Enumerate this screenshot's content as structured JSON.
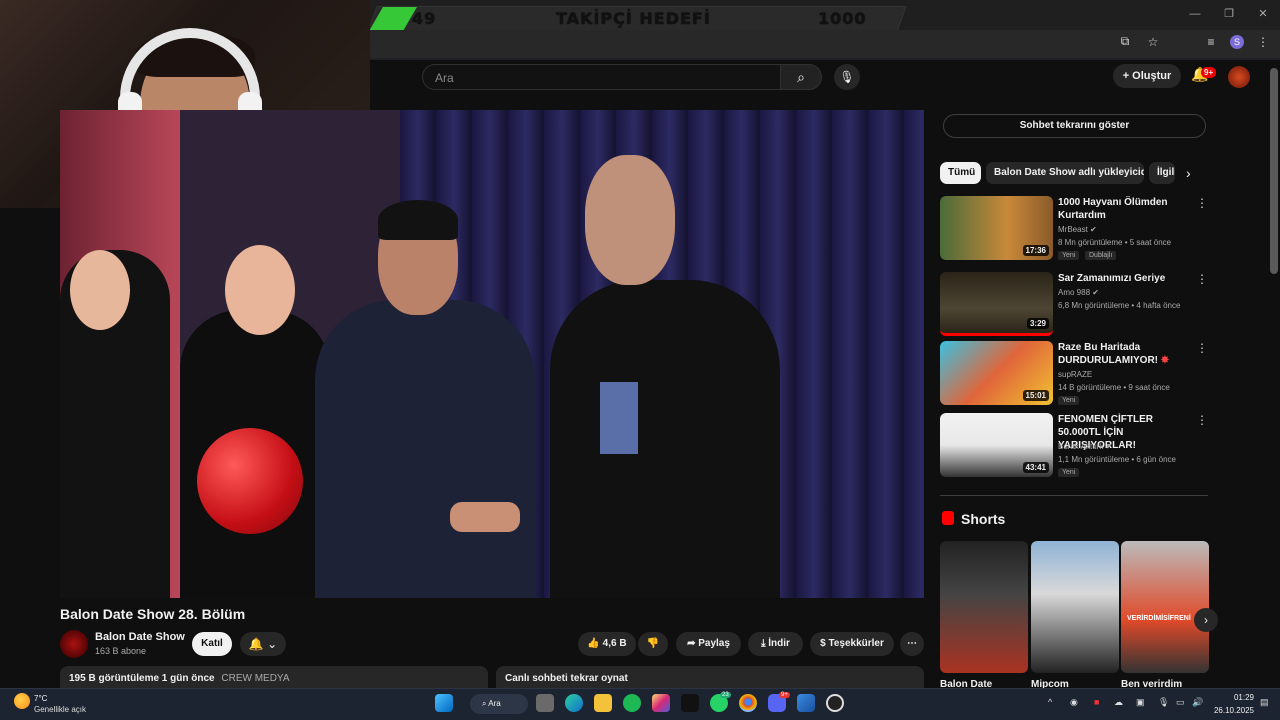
{
  "overlay": {
    "goal_left": "49",
    "goal_label": "TAKİPÇİ HEDEFİ",
    "goal_right": "1000"
  },
  "header": {
    "search_placeholder": "Ara",
    "create_label": "Oluştur",
    "notif_badge": "9+"
  },
  "video": {
    "title": "Balon Date Show 28. Bölüm",
    "channel": "Balon Date Show",
    "subscribers": "163 B abone",
    "join_label": "Katıl",
    "likes": "4,6 B",
    "share_label": "Paylaş",
    "download_label": "İndir",
    "thanks_label": "Teşekkürler",
    "views_line": "195 B görüntüleme  1 gün önce",
    "views_tag": "CREW MEDYA",
    "chat_replay": "Canlı sohbeti tekrar oynat"
  },
  "sidebar": {
    "show_chat": "Sohbet tekrarını göster",
    "chips": [
      "Tümü",
      "Balon Date Show adlı yükleyiciden",
      "İlgili"
    ],
    "recs": [
      {
        "title": "1000 Hayvanı Ölümden Kurtardım",
        "channel": "MrBeast",
        "meta": "8 Mn görüntüleme • 5 saat önce",
        "badge1": "Yeni",
        "badge2": "Dublajlı",
        "duration": "17:36"
      },
      {
        "title": "Sar Zamanımızı Geriye",
        "channel": "Amo 988",
        "meta": "6,8 Mn görüntüleme • 4 hafta önce",
        "duration": "3:29"
      },
      {
        "title": "Raze Bu Haritada DURDURULAMIYOR!",
        "channel": "supRAZE",
        "meta": "14 B görüntüleme • 9 saat önce",
        "badge1": "Yeni",
        "duration": "15:01"
      },
      {
        "title": "FENOMEN ÇİFTLER 50.000TL İÇİN YARIŞIYORLAR!",
        "channel": "Burak Aktürk",
        "meta": "1,1 Mn görüntüleme • 6 gün önce",
        "badge1": "Yeni",
        "duration": "43:41"
      }
    ],
    "shorts_title": "Shorts",
    "shorts": [
      {
        "title": "Balon Date"
      },
      {
        "title": "Mipcom"
      },
      {
        "title": "Ben verirdim"
      }
    ],
    "shorts_thumb_text": "VERİRDİMİSİFRENİ"
  },
  "taskbar": {
    "temp": "7°C",
    "weather": "Genellikle açık",
    "search": "Ara",
    "time": "01:29",
    "date": "26.10.2025",
    "whatsapp_badge": "23",
    "discord_badge": "9+"
  }
}
